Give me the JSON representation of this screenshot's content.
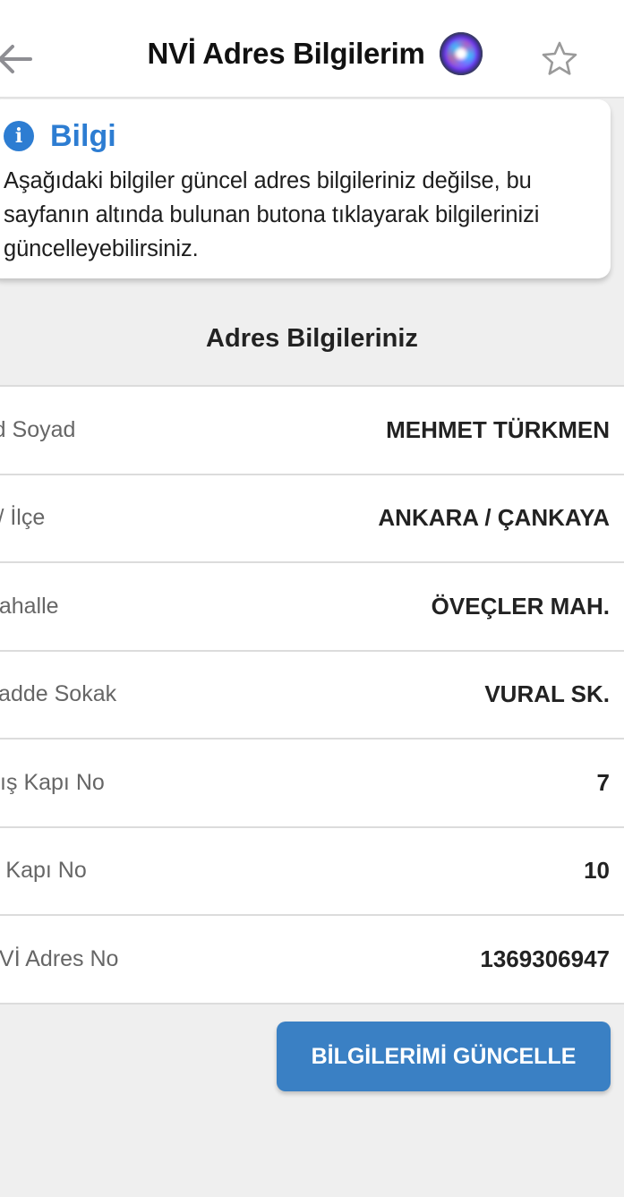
{
  "header": {
    "title": "NVİ Adres Bilgilerim",
    "back_icon": "arrow-left-icon",
    "siri_icon": "siri-icon",
    "favorite_icon": "star-outline-icon"
  },
  "info": {
    "icon": "info-icon",
    "icon_glyph": "i",
    "title": "Bilgi",
    "text": "Aşağıdaki bilgiler güncel adres bilgileriniz değilse, bu sayfanın altında bulunan butona tıklayarak bilgilerinizi güncelleyebilirsiniz."
  },
  "section": {
    "title": "Adres Bilgileriniz"
  },
  "rows": [
    {
      "label": "Ad Soyad",
      "value": "MEHMET TÜRKMEN"
    },
    {
      "label": "İl / İlçe",
      "value": "ANKARA / ÇANKAYA"
    },
    {
      "label": "Mahalle",
      "value": "ÖVEÇLER MAH."
    },
    {
      "label": "Cadde Sokak",
      "value": "VURAL SK."
    },
    {
      "label": "Dış Kapı No",
      "value": "7"
    },
    {
      "label": "İç Kapı No",
      "value": "10"
    },
    {
      "label": "NVİ Adres No",
      "value": "1369306947"
    }
  ],
  "actions": {
    "update_label": "BİLGİLERİMİ GÜNCELLE"
  },
  "colors": {
    "accent": "#2d7dd2",
    "button": "#3a80c4",
    "background": "#efefef"
  }
}
